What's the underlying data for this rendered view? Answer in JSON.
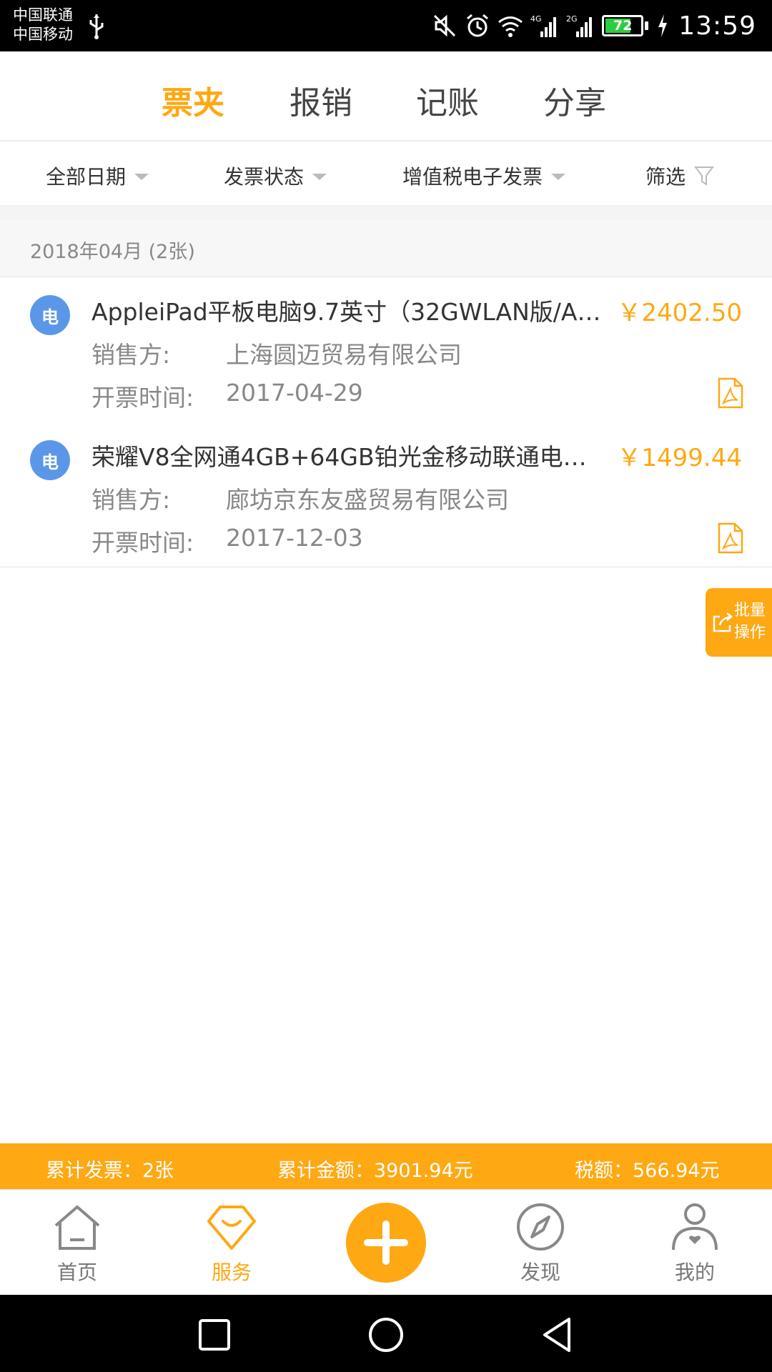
{
  "status_bar": {
    "carrier1": "中国联通",
    "carrier2": "中国移动",
    "net1": "4G",
    "net2": "2G",
    "battery": "72",
    "time": "13:59"
  },
  "tabs": [
    {
      "label": "票夹",
      "active": true
    },
    {
      "label": "报销",
      "active": false
    },
    {
      "label": "记账",
      "active": false
    },
    {
      "label": "分享",
      "active": false
    }
  ],
  "filters": {
    "date": "全部日期",
    "status": "发票状态",
    "type": "增值税电子发票",
    "filter": "筛选"
  },
  "month": {
    "header": "2018年04月 (2张)"
  },
  "invoices": [
    {
      "badge": "电",
      "title": "AppleiPad平板电脑9.7英寸（32GWLAN版/A…",
      "amount": "￥2402.50",
      "seller_label": "销售方:",
      "seller": "上海圆迈贸易有限公司",
      "date_label": "开票时间:",
      "date": "2017-04-29"
    },
    {
      "badge": "电",
      "title": "荣耀V8全网通4GB+64GB铂光金移动联通电…",
      "amount": "￥1499.44",
      "seller_label": "销售方:",
      "seller": "廊坊京东友盛贸易有限公司",
      "date_label": "开票时间:",
      "date": "2017-12-03"
    }
  ],
  "batch_button": {
    "line1": "批量",
    "line2": "操作"
  },
  "summary": {
    "count": "累计发票：2张",
    "total": "累计金额：3901.94元",
    "tax": "税额：566.94元"
  },
  "bottom_nav": [
    {
      "label": "首页",
      "icon": "home-icon"
    },
    {
      "label": "服务",
      "icon": "service-icon",
      "active": true
    },
    {
      "label": "",
      "icon": "plus-icon"
    },
    {
      "label": "发现",
      "icon": "compass-icon"
    },
    {
      "label": "我的",
      "icon": "user-icon"
    }
  ],
  "colors": {
    "accent": "#fea813",
    "badge": "#5b97e8"
  }
}
